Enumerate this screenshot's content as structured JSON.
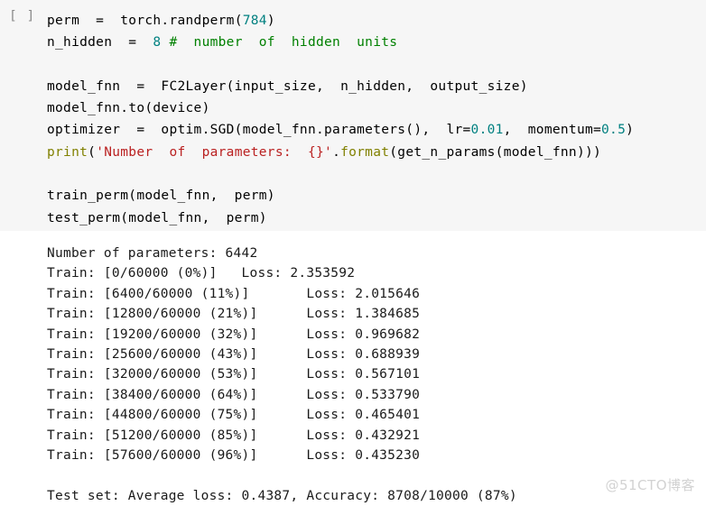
{
  "cell": {
    "prompt": "[ ]",
    "code_lines": [
      [
        {
          "t": "plain",
          "s": "perm  =  torch."
        },
        {
          "t": "plain",
          "s": "randperm"
        },
        {
          "t": "plain",
          "s": "("
        },
        {
          "t": "num",
          "s": "784"
        },
        {
          "t": "plain",
          "s": ")"
        }
      ],
      [
        {
          "t": "plain",
          "s": "n_hidden  =  "
        },
        {
          "t": "num",
          "s": "8"
        },
        {
          "t": "plain",
          "s": " "
        },
        {
          "t": "com",
          "s": "#  number  of  hidden  units"
        }
      ],
      [
        {
          "t": "plain",
          "s": ""
        }
      ],
      [
        {
          "t": "plain",
          "s": "model_fnn  =  FC2Layer(input_size,  n_hidden,  output_size)"
        }
      ],
      [
        {
          "t": "plain",
          "s": "model_fnn."
        },
        {
          "t": "plain",
          "s": "to(device)"
        }
      ],
      [
        {
          "t": "plain",
          "s": "optimizer  =  optim.SGD(model_fnn.parameters(),  lr="
        },
        {
          "t": "num",
          "s": "0.01"
        },
        {
          "t": "plain",
          "s": ",  momentum="
        },
        {
          "t": "num",
          "s": "0.5"
        },
        {
          "t": "plain",
          "s": ")"
        }
      ],
      [
        {
          "t": "fn",
          "s": "print"
        },
        {
          "t": "plain",
          "s": "("
        },
        {
          "t": "str",
          "s": "'Number  of  parameters:  {}'"
        },
        {
          "t": "plain",
          "s": "."
        },
        {
          "t": "fn",
          "s": "format"
        },
        {
          "t": "plain",
          "s": "(get_n_params(model_fnn)))"
        }
      ],
      [
        {
          "t": "plain",
          "s": ""
        }
      ],
      [
        {
          "t": "plain",
          "s": "train_perm(model_fnn,  perm)"
        }
      ],
      [
        {
          "t": "plain",
          "s": "test_perm(model_fnn,  perm)"
        }
      ]
    ]
  },
  "output": {
    "lines": [
      "Number of parameters: 6442",
      "Train: [0/60000 (0%)]   Loss: 2.353592",
      "Train: [6400/60000 (11%)]       Loss: 2.015646",
      "Train: [12800/60000 (21%)]      Loss: 1.384685",
      "Train: [19200/60000 (32%)]      Loss: 0.969682",
      "Train: [25600/60000 (43%)]      Loss: 0.688939",
      "Train: [32000/60000 (53%)]      Loss: 0.567101",
      "Train: [38400/60000 (64%)]      Loss: 0.533790",
      "Train: [44800/60000 (75%)]      Loss: 0.465401",
      "Train: [51200/60000 (85%)]      Loss: 0.432921",
      "Train: [57600/60000 (96%)]      Loss: 0.435230",
      "",
      "Test set: Average loss: 0.4387, Accuracy: 8708/10000 (87%)"
    ]
  },
  "watermark": {
    "text": "@51CTO博客"
  },
  "colors": {
    "cell_background": "#f6f6f6",
    "output_background": "#ffffff",
    "number_token": "#008080",
    "comment_token": "#008000",
    "string_token": "#ba2121",
    "function_token": "#808000",
    "plain_token": "#000000",
    "prompt": "#8a8a8a",
    "watermark": "#d2d2d2"
  }
}
